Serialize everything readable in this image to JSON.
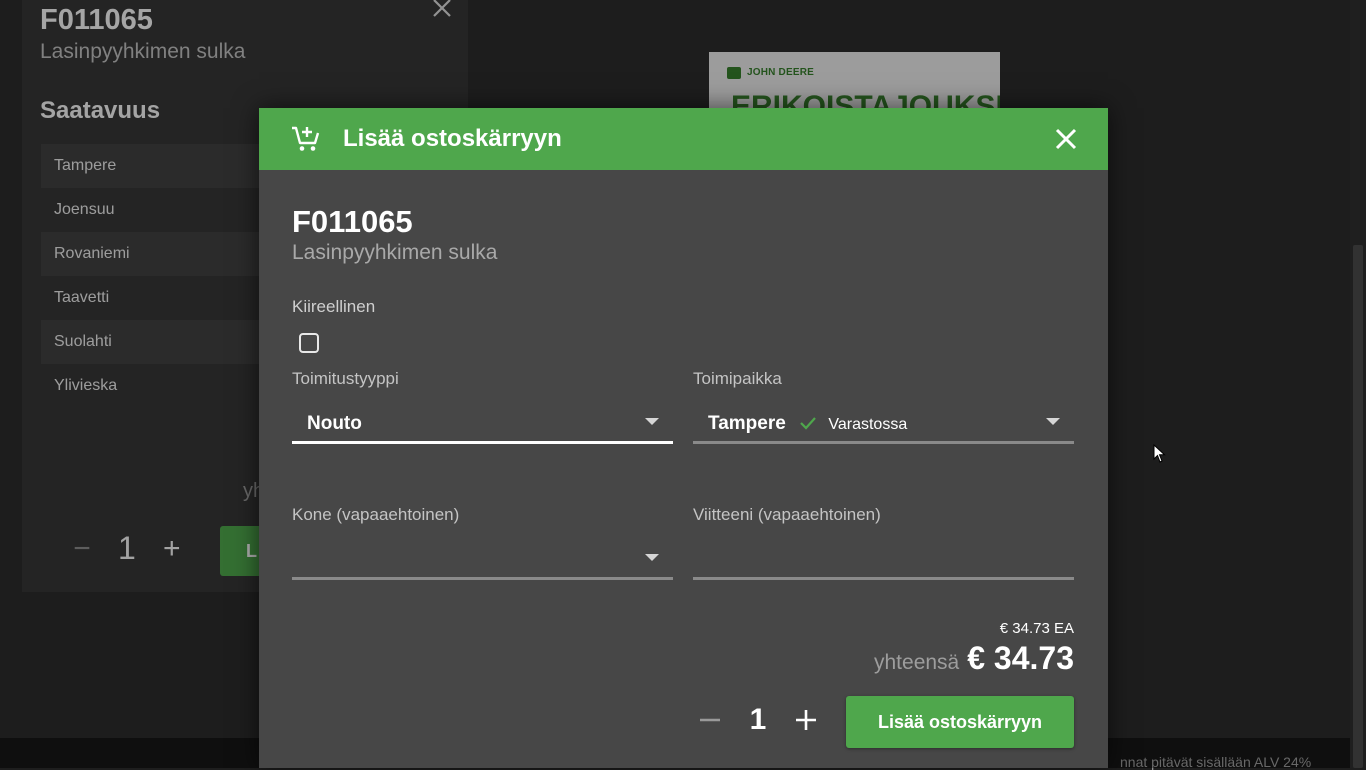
{
  "background": {
    "product_code": "F011065",
    "product_name": "Lasinpyyhkimen sulka",
    "availability_heading": "Saatavuus",
    "locations": [
      "Tampere",
      "Joensuu",
      "Rovaniemi",
      "Taavetti",
      "Suolahti",
      "Ylivieska"
    ],
    "partial_total_label": "yh",
    "quantity": "1",
    "button_partial": "L",
    "promo_brand": "JOHN DEERE",
    "promo_headline": "ERIKOISTAJOUKSIA",
    "footer_text": "nnat pitävät sisällään ALV 24%"
  },
  "modal": {
    "title": "Lisää ostoskärryyn",
    "product_code": "F011065",
    "product_name": "Lasinpyyhkimen sulka",
    "urgent_label": "Kiireellinen",
    "urgent_checked": false,
    "delivery_type": {
      "label": "Toimitustyyppi",
      "value": "Nouto"
    },
    "location": {
      "label": "Toimipaikka",
      "value": "Tampere",
      "stock_status": "Varastossa"
    },
    "machine": {
      "label": "Kone (vapaaehtoinen)",
      "value": ""
    },
    "reference": {
      "label": "Viitteeni (vapaaehtoinen)",
      "value": ""
    },
    "unit_price": "€ 34.73",
    "unit": "EA",
    "total_label": "yhteensä",
    "total_value": "€ 34.73",
    "quantity": "1",
    "add_button": "Lisää ostoskärryyn"
  },
  "colors": {
    "accent": "#4fa74c",
    "modal_bg": "#474747",
    "stock_ok": "#4fa74c"
  }
}
